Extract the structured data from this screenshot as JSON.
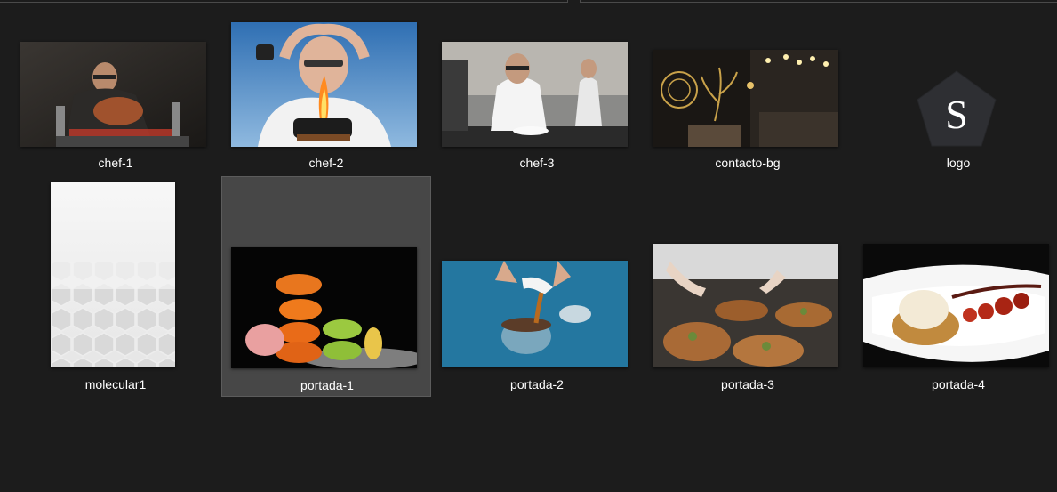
{
  "files": [
    {
      "name": "chef-1"
    },
    {
      "name": "chef-2"
    },
    {
      "name": "chef-3"
    },
    {
      "name": "contacto-bg"
    },
    {
      "name": "logo",
      "logo_letter": "S"
    },
    {
      "name": "molecular1"
    },
    {
      "name": "portada-1",
      "selected": true
    },
    {
      "name": "portada-2"
    },
    {
      "name": "portada-3"
    },
    {
      "name": "portada-4"
    }
  ]
}
